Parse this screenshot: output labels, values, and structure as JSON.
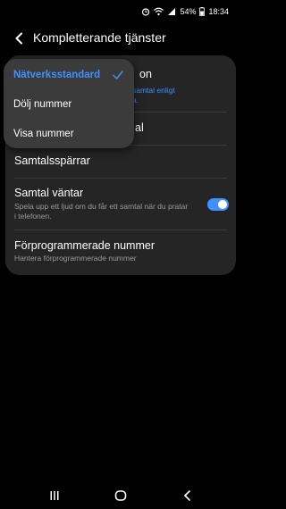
{
  "status": {
    "battery": "54%",
    "time": "18:34",
    "icons": [
      "alarm-icon",
      "wifi-icon",
      "signal-icon",
      "battery-icon"
    ]
  },
  "header": {
    "title": "Kompletterande tjänster",
    "back_icon": "back-arrow-icon"
  },
  "settings": {
    "caller_id_title_fragment": "on",
    "caller_id_sub_line1": "samtal enligt",
    "caller_id_sub_line2": "a.",
    "call_forward_fragment": "al",
    "call_barring_title": "Samtalsspärrar",
    "call_waiting_title": "Samtal väntar",
    "call_waiting_sub": "Spela upp ett ljud om du får ett samtal när du pratar i telefonen.",
    "call_waiting_enabled": true,
    "preset_numbers_title": "Förprogrammerade nummer",
    "preset_numbers_sub": "Hantera förprogrammerade nummer"
  },
  "popup": {
    "items": [
      {
        "label": "Nätverksstandard",
        "selected": true
      },
      {
        "label": "Dölj nummer",
        "selected": false
      },
      {
        "label": "Visa nummer",
        "selected": false
      }
    ]
  },
  "nav": {
    "recent_icon": "recent-apps-icon",
    "home_icon": "home-icon",
    "back_icon": "back-icon"
  },
  "colors": {
    "accent": "#3e91ff",
    "card": "#252525",
    "popup": "#3b3b3b",
    "background": "#000000"
  }
}
